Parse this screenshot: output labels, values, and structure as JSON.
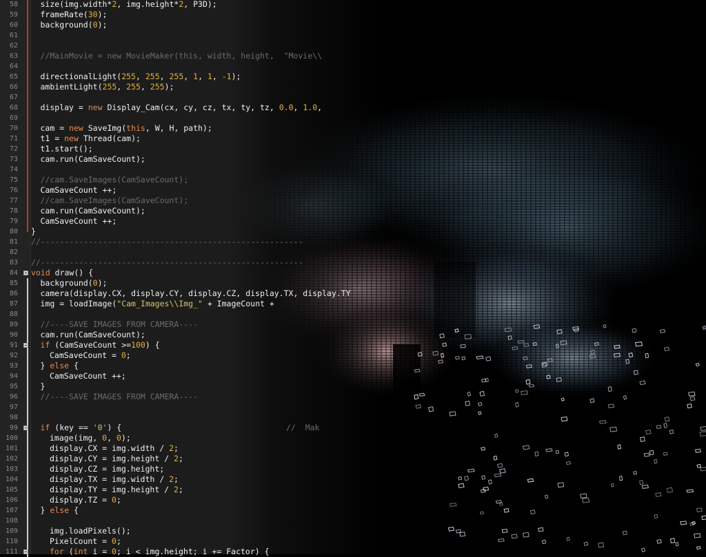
{
  "editor": {
    "lines": [
      {
        "n": "58",
        "indent": 1,
        "bar": "red",
        "tokens": [
          [
            "p",
            "size(img.width*"
          ],
          [
            "n",
            "2"
          ],
          [
            "p",
            ", img.height*"
          ],
          [
            "n",
            "2"
          ],
          [
            "p",
            ", P3D);"
          ]
        ]
      },
      {
        "n": "59",
        "indent": 1,
        "bar": "red",
        "tokens": [
          [
            "p",
            "frameRate("
          ],
          [
            "n",
            "30"
          ],
          [
            "p",
            ");"
          ]
        ]
      },
      {
        "n": "60",
        "indent": 1,
        "bar": "red",
        "tokens": [
          [
            "p",
            "background("
          ],
          [
            "n",
            "0"
          ],
          [
            "p",
            ");"
          ]
        ]
      },
      {
        "n": "61",
        "indent": 0,
        "bar": "red",
        "tokens": []
      },
      {
        "n": "62",
        "indent": 0,
        "bar": "red",
        "tokens": []
      },
      {
        "n": "63",
        "indent": 1,
        "bar": "red",
        "tokens": [
          [
            "c",
            "//MainMovie = new MovieMaker(this, width, height,  \"Movie\\\\"
          ]
        ]
      },
      {
        "n": "64",
        "indent": 0,
        "bar": "red",
        "tokens": []
      },
      {
        "n": "65",
        "indent": 1,
        "bar": "red",
        "tokens": [
          [
            "p",
            "directionalLight("
          ],
          [
            "n",
            "255"
          ],
          [
            "p",
            ", "
          ],
          [
            "n",
            "255"
          ],
          [
            "p",
            ", "
          ],
          [
            "n",
            "255"
          ],
          [
            "p",
            ", "
          ],
          [
            "n",
            "1"
          ],
          [
            "p",
            ", "
          ],
          [
            "n",
            "1"
          ],
          [
            "p",
            ", "
          ],
          [
            "n",
            "-1"
          ],
          [
            "p",
            ");"
          ]
        ]
      },
      {
        "n": "66",
        "indent": 1,
        "bar": "red",
        "tokens": [
          [
            "p",
            "ambientLight("
          ],
          [
            "n",
            "255"
          ],
          [
            "p",
            ", "
          ],
          [
            "n",
            "255"
          ],
          [
            "p",
            ", "
          ],
          [
            "n",
            "255"
          ],
          [
            "p",
            ");"
          ]
        ]
      },
      {
        "n": "67",
        "indent": 0,
        "bar": "red",
        "tokens": []
      },
      {
        "n": "68",
        "indent": 1,
        "bar": "red",
        "tokens": [
          [
            "p",
            "display = "
          ],
          [
            "k",
            "new"
          ],
          [
            "p",
            " Display_Cam(cx, cy, cz, tx, ty, tz, "
          ],
          [
            "n",
            "0.0"
          ],
          [
            "p",
            ", "
          ],
          [
            "n",
            "1.0"
          ],
          [
            "p",
            ", "
          ]
        ]
      },
      {
        "n": "69",
        "indent": 0,
        "bar": "red",
        "tokens": []
      },
      {
        "n": "70",
        "indent": 1,
        "bar": "red",
        "tokens": [
          [
            "p",
            "cam = "
          ],
          [
            "k",
            "new"
          ],
          [
            "p",
            " SaveImg("
          ],
          [
            "k",
            "this"
          ],
          [
            "p",
            ", W, H, path);"
          ]
        ]
      },
      {
        "n": "71",
        "indent": 1,
        "bar": "red",
        "tokens": [
          [
            "p",
            "t1 = "
          ],
          [
            "k",
            "new"
          ],
          [
            "p",
            " Thread(cam);"
          ]
        ]
      },
      {
        "n": "72",
        "indent": 1,
        "bar": "red",
        "tokens": [
          [
            "p",
            "t1.start();"
          ]
        ]
      },
      {
        "n": "73",
        "indent": 1,
        "bar": "red",
        "tokens": [
          [
            "p",
            "cam.run(CamSaveCount);"
          ]
        ]
      },
      {
        "n": "74",
        "indent": 0,
        "bar": "red",
        "tokens": []
      },
      {
        "n": "75",
        "indent": 1,
        "bar": "red",
        "tokens": [
          [
            "c",
            "//cam.SaveImages(CamSaveCount);"
          ]
        ]
      },
      {
        "n": "76",
        "indent": 1,
        "bar": "red",
        "tokens": [
          [
            "p",
            "CamSaveCount ++;"
          ]
        ]
      },
      {
        "n": "77",
        "indent": 1,
        "bar": "red",
        "tokens": [
          [
            "c",
            "//cam.SaveImages(CamSaveCount);"
          ]
        ]
      },
      {
        "n": "78",
        "indent": 1,
        "bar": "red",
        "tokens": [
          [
            "p",
            "cam.run(CamSaveCount);"
          ]
        ]
      },
      {
        "n": "79",
        "indent": 1,
        "bar": "red",
        "tokens": [
          [
            "p",
            "CamSaveCount ++;"
          ]
        ]
      },
      {
        "n": "80",
        "indent": 0,
        "bar": "end",
        "tokens": [
          [
            "p",
            "}"
          ]
        ]
      },
      {
        "n": "81",
        "indent": 0,
        "bar": "",
        "tokens": [
          [
            "c",
            "//-------------------------------------------------------"
          ]
        ]
      },
      {
        "n": "82",
        "indent": 0,
        "bar": "",
        "tokens": []
      },
      {
        "n": "83",
        "indent": 0,
        "bar": "",
        "tokens": [
          [
            "c",
            "//-------------------------------------------------------"
          ]
        ]
      },
      {
        "n": "84",
        "indent": 0,
        "bar": "",
        "fold": true,
        "tokens": [
          [
            "k",
            "void"
          ],
          [
            "p",
            " draw() {"
          ]
        ]
      },
      {
        "n": "85",
        "indent": 1,
        "bar": "white",
        "tokens": [
          [
            "p",
            "background("
          ],
          [
            "n",
            "0"
          ],
          [
            "p",
            ");"
          ]
        ]
      },
      {
        "n": "86",
        "indent": 1,
        "bar": "white",
        "tokens": [
          [
            "p",
            "camera(display.CX, display.CY, display.CZ, display.TX, display.TY"
          ]
        ]
      },
      {
        "n": "87",
        "indent": 1,
        "bar": "white",
        "tokens": [
          [
            "p",
            "img = loadImage("
          ],
          [
            "s",
            "\"Cam_Images\\\\Img_\""
          ],
          [
            "p",
            " + ImageCount + "
          ]
        ]
      },
      {
        "n": "88",
        "indent": 0,
        "bar": "white",
        "tokens": []
      },
      {
        "n": "89",
        "indent": 1,
        "bar": "white",
        "tokens": [
          [
            "c",
            "//----SAVE IMAGES FROM CAMERA----"
          ]
        ]
      },
      {
        "n": "90",
        "indent": 1,
        "bar": "white",
        "tokens": [
          [
            "p",
            "cam.run(CamSaveCount);"
          ]
        ]
      },
      {
        "n": "91",
        "indent": 1,
        "bar": "white",
        "fold": true,
        "tokens": [
          [
            "k",
            "if"
          ],
          [
            "p",
            " (CamSaveCount >="
          ],
          [
            "n",
            "100"
          ],
          [
            "p",
            ") {"
          ]
        ]
      },
      {
        "n": "92",
        "indent": 2,
        "bar": "white",
        "tokens": [
          [
            "p",
            "CamSaveCount = "
          ],
          [
            "n",
            "0"
          ],
          [
            "p",
            ";"
          ]
        ]
      },
      {
        "n": "93",
        "indent": 1,
        "bar": "white",
        "tokens": [
          [
            "p",
            "} "
          ],
          [
            "k",
            "else"
          ],
          [
            "p",
            " {"
          ]
        ]
      },
      {
        "n": "94",
        "indent": 2,
        "bar": "white",
        "tokens": [
          [
            "p",
            "CamSaveCount ++;"
          ]
        ]
      },
      {
        "n": "95",
        "indent": 1,
        "bar": "white",
        "tokens": [
          [
            "p",
            "}"
          ]
        ]
      },
      {
        "n": "96",
        "indent": 1,
        "bar": "white",
        "tokens": [
          [
            "c",
            "//----SAVE IMAGES FROM CAMERA----"
          ]
        ]
      },
      {
        "n": "97",
        "indent": 0,
        "bar": "white",
        "tokens": []
      },
      {
        "n": "98",
        "indent": 0,
        "bar": "white",
        "tokens": []
      },
      {
        "n": "99",
        "indent": 1,
        "bar": "white",
        "fold": true,
        "tokens": [
          [
            "k",
            "if"
          ],
          [
            "p",
            " (key == "
          ],
          [
            "s",
            "'0'"
          ],
          [
            "p",
            ") {"
          ]
        ]
      },
      {
        "n": "100",
        "indent": 2,
        "bar": "white",
        "tokens": [
          [
            "p",
            "image(img, "
          ],
          [
            "n",
            "0"
          ],
          [
            "p",
            ", "
          ],
          [
            "n",
            "0"
          ],
          [
            "p",
            ");"
          ]
        ]
      },
      {
        "n": "101",
        "indent": 2,
        "bar": "white",
        "tokens": [
          [
            "p",
            "display.CX = img.width / "
          ],
          [
            "n",
            "2"
          ],
          [
            "p",
            ";"
          ]
        ]
      },
      {
        "n": "102",
        "indent": 2,
        "bar": "white",
        "tokens": [
          [
            "p",
            "display.CY = img.height / "
          ],
          [
            "n",
            "2"
          ],
          [
            "p",
            ";"
          ]
        ]
      },
      {
        "n": "103",
        "indent": 2,
        "bar": "white",
        "tokens": [
          [
            "p",
            "display.CZ = img.height;"
          ]
        ]
      },
      {
        "n": "104",
        "indent": 2,
        "bar": "white",
        "tokens": [
          [
            "p",
            "display.TX = img.width / "
          ],
          [
            "n",
            "2"
          ],
          [
            "p",
            ";"
          ]
        ]
      },
      {
        "n": "105",
        "indent": 2,
        "bar": "white",
        "tokens": [
          [
            "p",
            "display.TY = img.height / "
          ],
          [
            "n",
            "2"
          ],
          [
            "p",
            ";"
          ]
        ]
      },
      {
        "n": "106",
        "indent": 2,
        "bar": "white",
        "tokens": [
          [
            "p",
            "display.TZ = "
          ],
          [
            "n",
            "0"
          ],
          [
            "p",
            ";"
          ]
        ]
      },
      {
        "n": "107",
        "indent": 1,
        "bar": "white",
        "tokens": [
          [
            "p",
            "} "
          ],
          [
            "k",
            "else"
          ],
          [
            "p",
            " {"
          ]
        ]
      },
      {
        "n": "108",
        "indent": 0,
        "bar": "white",
        "tokens": []
      },
      {
        "n": "109",
        "indent": 2,
        "bar": "white",
        "tokens": [
          [
            "p",
            "img.loadPixels();"
          ]
        ]
      },
      {
        "n": "110",
        "indent": 2,
        "bar": "white",
        "tokens": [
          [
            "p",
            "PixelCount = "
          ],
          [
            "n",
            "0"
          ],
          [
            "p",
            ";"
          ]
        ]
      },
      {
        "n": "111",
        "indent": 2,
        "bar": "white",
        "fold": true,
        "tokens": [
          [
            "k",
            "for"
          ],
          [
            "p",
            " ("
          ],
          [
            "k",
            "int"
          ],
          [
            "p",
            " i = "
          ],
          [
            "n",
            "0"
          ],
          [
            "p",
            "; i < img.height; i += Factor) {"
          ]
        ]
      }
    ],
    "overlay_comment": "//  Mak"
  },
  "colors": {
    "background": "#000000",
    "editor_bg": "#1c1c1c",
    "keyword": "#e58a53",
    "number": "#e5b23a",
    "string": "#d4c46a",
    "comment": "#6b6b6b",
    "text": "#f0f0f0"
  }
}
